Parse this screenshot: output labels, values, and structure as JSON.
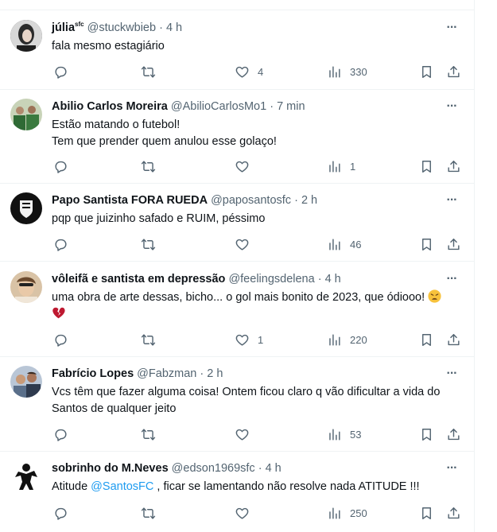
{
  "tweets": [
    {
      "name": "júlia",
      "name_sup": "sfc",
      "handle": "@stuckwbieb",
      "time": "4 h",
      "text": "fala mesmo estagiário",
      "replies": "",
      "retweets": "",
      "likes": "4",
      "views": "330",
      "avatar_color": "#4a4a4a"
    },
    {
      "name": "Abilio Carlos Moreira",
      "handle": "@AbilioCarlosMo1",
      "time": "7 min",
      "text": "Estão matando o futebol!\nTem que prender quem anulou esse golaço!",
      "likes": "",
      "views": "1",
      "avatar_color": "#3d6b3a"
    },
    {
      "name": "Papo Santista FORA RUEDA",
      "handle": "@paposantosfc",
      "time": "2 h",
      "text": "pqp que juizinho safado e RUIM, péssimo",
      "likes": "",
      "views": "46",
      "avatar_color": "#1a1a1a"
    },
    {
      "name": "vôleifã e santista em depressão",
      "handle": "@feelingsdelena",
      "time": "4 h",
      "text": "uma obra de arte dessas, bicho... o gol mais bonito de 2023, que ódiooo!",
      "likes": "1",
      "views": "220",
      "avatar_color": "#c9a27a"
    },
    {
      "name": "Fabrício Lopes",
      "handle": "@Fabzman",
      "time": "2 h",
      "text": "Vcs têm que fazer alguma coisa! Ontem ficou claro q vão dificultar a vida do Santos de qualquer jeito",
      "likes": "",
      "views": "53",
      "avatar_color": "#7a8fa8"
    },
    {
      "name": "sobrinho do M.Neves",
      "handle": "@edson1969sfc",
      "time": "4 h",
      "text_before": "Atitude ",
      "mention": "@SantosFC",
      "text_after": " , ficar se lamentando não resolve nada ATITUDE !!!",
      "likes": "",
      "views": "250",
      "avatar_color": "#ffffff"
    }
  ],
  "ui": {
    "dot": "·",
    "more": "···",
    "icons": [
      "reply-icon",
      "retweet-icon",
      "like-icon",
      "views-icon",
      "bookmark-icon",
      "share-icon",
      "more-icon"
    ]
  },
  "colors": {
    "text": "#0f1419",
    "secondary": "#536471",
    "link": "#1d9bf0",
    "border": "#eff3f4"
  }
}
